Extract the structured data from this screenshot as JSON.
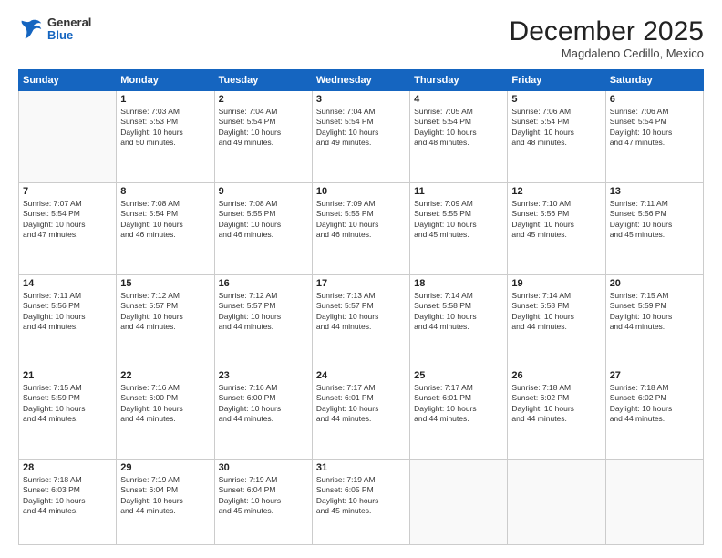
{
  "header": {
    "logo": {
      "general": "General",
      "blue": "Blue"
    },
    "title": "December 2025",
    "subtitle": "Magdaleno Cedillo, Mexico"
  },
  "calendar": {
    "weekdays": [
      "Sunday",
      "Monday",
      "Tuesday",
      "Wednesday",
      "Thursday",
      "Friday",
      "Saturday"
    ],
    "weeks": [
      [
        {
          "day": "",
          "info": ""
        },
        {
          "day": "1",
          "info": "Sunrise: 7:03 AM\nSunset: 5:53 PM\nDaylight: 10 hours\nand 50 minutes."
        },
        {
          "day": "2",
          "info": "Sunrise: 7:04 AM\nSunset: 5:54 PM\nDaylight: 10 hours\nand 49 minutes."
        },
        {
          "day": "3",
          "info": "Sunrise: 7:04 AM\nSunset: 5:54 PM\nDaylight: 10 hours\nand 49 minutes."
        },
        {
          "day": "4",
          "info": "Sunrise: 7:05 AM\nSunset: 5:54 PM\nDaylight: 10 hours\nand 48 minutes."
        },
        {
          "day": "5",
          "info": "Sunrise: 7:06 AM\nSunset: 5:54 PM\nDaylight: 10 hours\nand 48 minutes."
        },
        {
          "day": "6",
          "info": "Sunrise: 7:06 AM\nSunset: 5:54 PM\nDaylight: 10 hours\nand 47 minutes."
        }
      ],
      [
        {
          "day": "7",
          "info": "Sunrise: 7:07 AM\nSunset: 5:54 PM\nDaylight: 10 hours\nand 47 minutes."
        },
        {
          "day": "8",
          "info": "Sunrise: 7:08 AM\nSunset: 5:54 PM\nDaylight: 10 hours\nand 46 minutes."
        },
        {
          "day": "9",
          "info": "Sunrise: 7:08 AM\nSunset: 5:55 PM\nDaylight: 10 hours\nand 46 minutes."
        },
        {
          "day": "10",
          "info": "Sunrise: 7:09 AM\nSunset: 5:55 PM\nDaylight: 10 hours\nand 46 minutes."
        },
        {
          "day": "11",
          "info": "Sunrise: 7:09 AM\nSunset: 5:55 PM\nDaylight: 10 hours\nand 45 minutes."
        },
        {
          "day": "12",
          "info": "Sunrise: 7:10 AM\nSunset: 5:56 PM\nDaylight: 10 hours\nand 45 minutes."
        },
        {
          "day": "13",
          "info": "Sunrise: 7:11 AM\nSunset: 5:56 PM\nDaylight: 10 hours\nand 45 minutes."
        }
      ],
      [
        {
          "day": "14",
          "info": "Sunrise: 7:11 AM\nSunset: 5:56 PM\nDaylight: 10 hours\nand 44 minutes."
        },
        {
          "day": "15",
          "info": "Sunrise: 7:12 AM\nSunset: 5:57 PM\nDaylight: 10 hours\nand 44 minutes."
        },
        {
          "day": "16",
          "info": "Sunrise: 7:12 AM\nSunset: 5:57 PM\nDaylight: 10 hours\nand 44 minutes."
        },
        {
          "day": "17",
          "info": "Sunrise: 7:13 AM\nSunset: 5:57 PM\nDaylight: 10 hours\nand 44 minutes."
        },
        {
          "day": "18",
          "info": "Sunrise: 7:14 AM\nSunset: 5:58 PM\nDaylight: 10 hours\nand 44 minutes."
        },
        {
          "day": "19",
          "info": "Sunrise: 7:14 AM\nSunset: 5:58 PM\nDaylight: 10 hours\nand 44 minutes."
        },
        {
          "day": "20",
          "info": "Sunrise: 7:15 AM\nSunset: 5:59 PM\nDaylight: 10 hours\nand 44 minutes."
        }
      ],
      [
        {
          "day": "21",
          "info": "Sunrise: 7:15 AM\nSunset: 5:59 PM\nDaylight: 10 hours\nand 44 minutes."
        },
        {
          "day": "22",
          "info": "Sunrise: 7:16 AM\nSunset: 6:00 PM\nDaylight: 10 hours\nand 44 minutes."
        },
        {
          "day": "23",
          "info": "Sunrise: 7:16 AM\nSunset: 6:00 PM\nDaylight: 10 hours\nand 44 minutes."
        },
        {
          "day": "24",
          "info": "Sunrise: 7:17 AM\nSunset: 6:01 PM\nDaylight: 10 hours\nand 44 minutes."
        },
        {
          "day": "25",
          "info": "Sunrise: 7:17 AM\nSunset: 6:01 PM\nDaylight: 10 hours\nand 44 minutes."
        },
        {
          "day": "26",
          "info": "Sunrise: 7:18 AM\nSunset: 6:02 PM\nDaylight: 10 hours\nand 44 minutes."
        },
        {
          "day": "27",
          "info": "Sunrise: 7:18 AM\nSunset: 6:02 PM\nDaylight: 10 hours\nand 44 minutes."
        }
      ],
      [
        {
          "day": "28",
          "info": "Sunrise: 7:18 AM\nSunset: 6:03 PM\nDaylight: 10 hours\nand 44 minutes."
        },
        {
          "day": "29",
          "info": "Sunrise: 7:19 AM\nSunset: 6:04 PM\nDaylight: 10 hours\nand 44 minutes."
        },
        {
          "day": "30",
          "info": "Sunrise: 7:19 AM\nSunset: 6:04 PM\nDaylight: 10 hours\nand 45 minutes."
        },
        {
          "day": "31",
          "info": "Sunrise: 7:19 AM\nSunset: 6:05 PM\nDaylight: 10 hours\nand 45 minutes."
        },
        {
          "day": "",
          "info": ""
        },
        {
          "day": "",
          "info": ""
        },
        {
          "day": "",
          "info": ""
        }
      ]
    ]
  }
}
